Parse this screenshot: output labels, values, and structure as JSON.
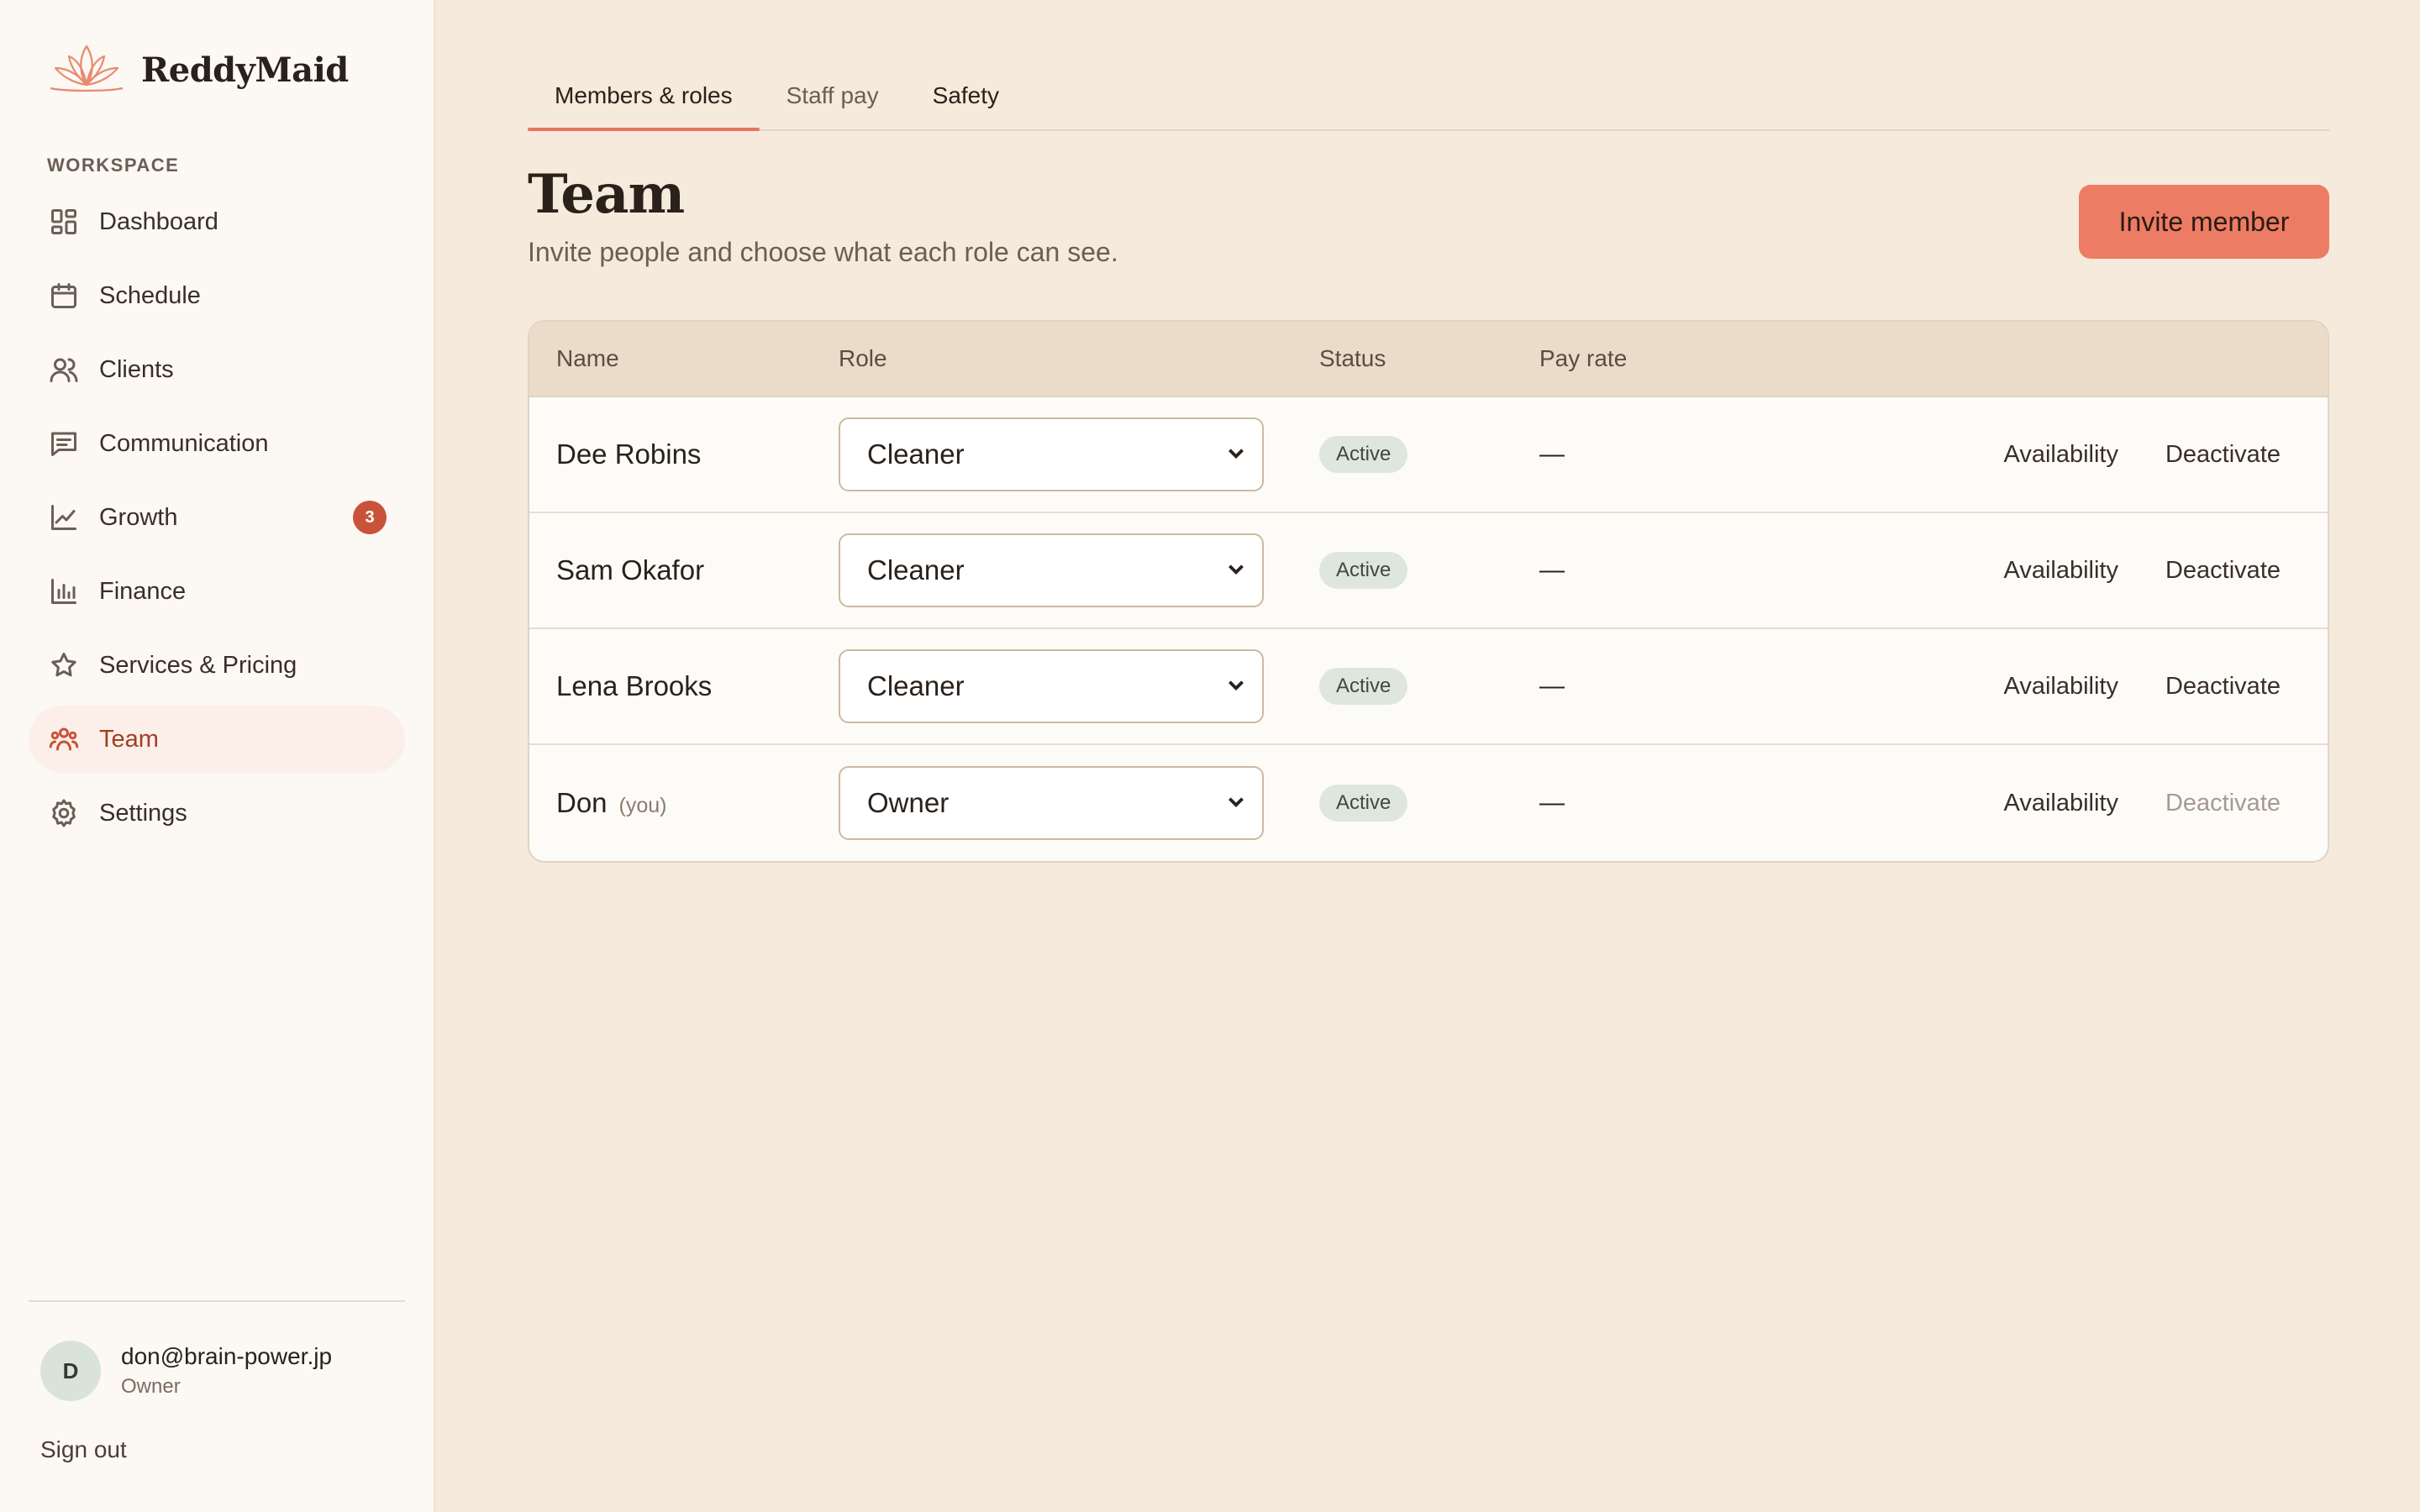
{
  "brand": {
    "name": "ReddyMaid"
  },
  "sidebar": {
    "section_label": "WORKSPACE",
    "items": [
      {
        "label": "Dashboard",
        "icon": "dashboard-icon"
      },
      {
        "label": "Schedule",
        "icon": "calendar-icon"
      },
      {
        "label": "Clients",
        "icon": "users-icon"
      },
      {
        "label": "Communication",
        "icon": "message-icon"
      },
      {
        "label": "Growth",
        "icon": "trend-icon",
        "badge": "3"
      },
      {
        "label": "Finance",
        "icon": "bar-chart-icon"
      },
      {
        "label": "Services & Pricing",
        "icon": "star-icon"
      },
      {
        "label": "Team",
        "icon": "team-icon",
        "active": true
      },
      {
        "label": "Settings",
        "icon": "gear-icon"
      }
    ],
    "user": {
      "initial": "D",
      "email": "don@brain-power.jp",
      "role": "Owner"
    },
    "sign_out": "Sign out"
  },
  "tabs": [
    "Members & roles",
    "Staff pay",
    "Safety"
  ],
  "header": {
    "title": "Team",
    "subtitle": "Invite people and choose what each role can see.",
    "invite_label": "Invite member"
  },
  "table": {
    "columns": [
      "Name",
      "Role",
      "Status",
      "Pay rate"
    ],
    "rows": [
      {
        "name": "Dee Robins",
        "you": "",
        "role": "Cleaner",
        "status": "Active",
        "pay": "—",
        "availability": "Availability",
        "deactivate": "Deactivate"
      },
      {
        "name": "Sam Okafor",
        "you": "",
        "role": "Cleaner",
        "status": "Active",
        "pay": "—",
        "availability": "Availability",
        "deactivate": "Deactivate"
      },
      {
        "name": "Lena Brooks",
        "you": "",
        "role": "Cleaner",
        "status": "Active",
        "pay": "—",
        "availability": "Availability",
        "deactivate": "Deactivate"
      },
      {
        "name": "Don",
        "you": "(you)",
        "role": "Owner",
        "status": "Active",
        "pay": "—",
        "availability": "Availability",
        "deactivate": "Deactivate"
      }
    ]
  },
  "colors": {
    "accent": "#ec7c63",
    "active_nav_bg": "#fcefe9",
    "badge": "#c9533a",
    "page_bg": "#f5eadc",
    "status_pill": "#dfe6de"
  }
}
